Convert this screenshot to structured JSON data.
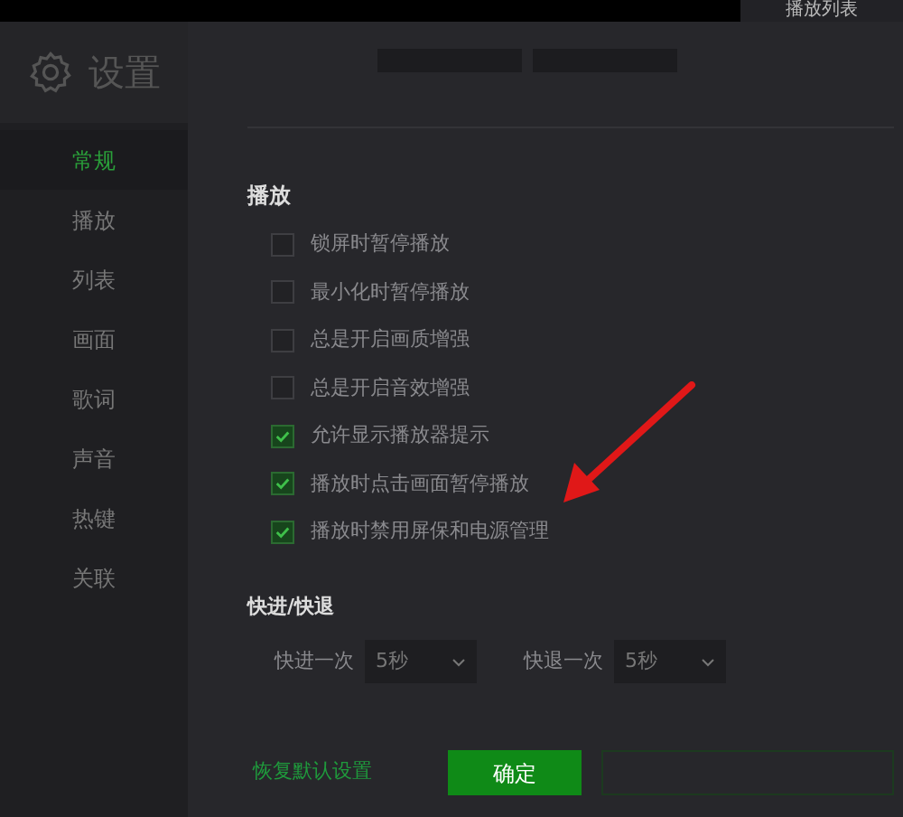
{
  "top_tab": {
    "label": "播放列表"
  },
  "sidebar": {
    "title": "设置",
    "items": [
      {
        "label": "常规",
        "selected": true
      },
      {
        "label": "播放",
        "selected": false
      },
      {
        "label": "列表",
        "selected": false
      },
      {
        "label": "画面",
        "selected": false
      },
      {
        "label": "歌词",
        "selected": false
      },
      {
        "label": "声音",
        "selected": false
      },
      {
        "label": "热键",
        "selected": false
      },
      {
        "label": "关联",
        "selected": false
      }
    ]
  },
  "playback": {
    "heading": "播放",
    "options": [
      {
        "label": "锁屏时暂停播放",
        "checked": false
      },
      {
        "label": "最小化时暂停播放",
        "checked": false
      },
      {
        "label": "总是开启画质增强",
        "checked": false
      },
      {
        "label": "总是开启音效增强",
        "checked": false
      },
      {
        "label": "允许显示播放器提示",
        "checked": true
      },
      {
        "label": "播放时点击画面暂停播放",
        "checked": true
      },
      {
        "label": "播放时禁用屏保和电源管理",
        "checked": true
      }
    ]
  },
  "seek": {
    "heading": "快进/快退",
    "fields": [
      {
        "label": "快进一次",
        "value": "5秒"
      },
      {
        "label": "快退一次",
        "value": "5秒"
      }
    ]
  },
  "footer": {
    "reset_link": "恢复默认设置",
    "ok_button": "确定"
  }
}
